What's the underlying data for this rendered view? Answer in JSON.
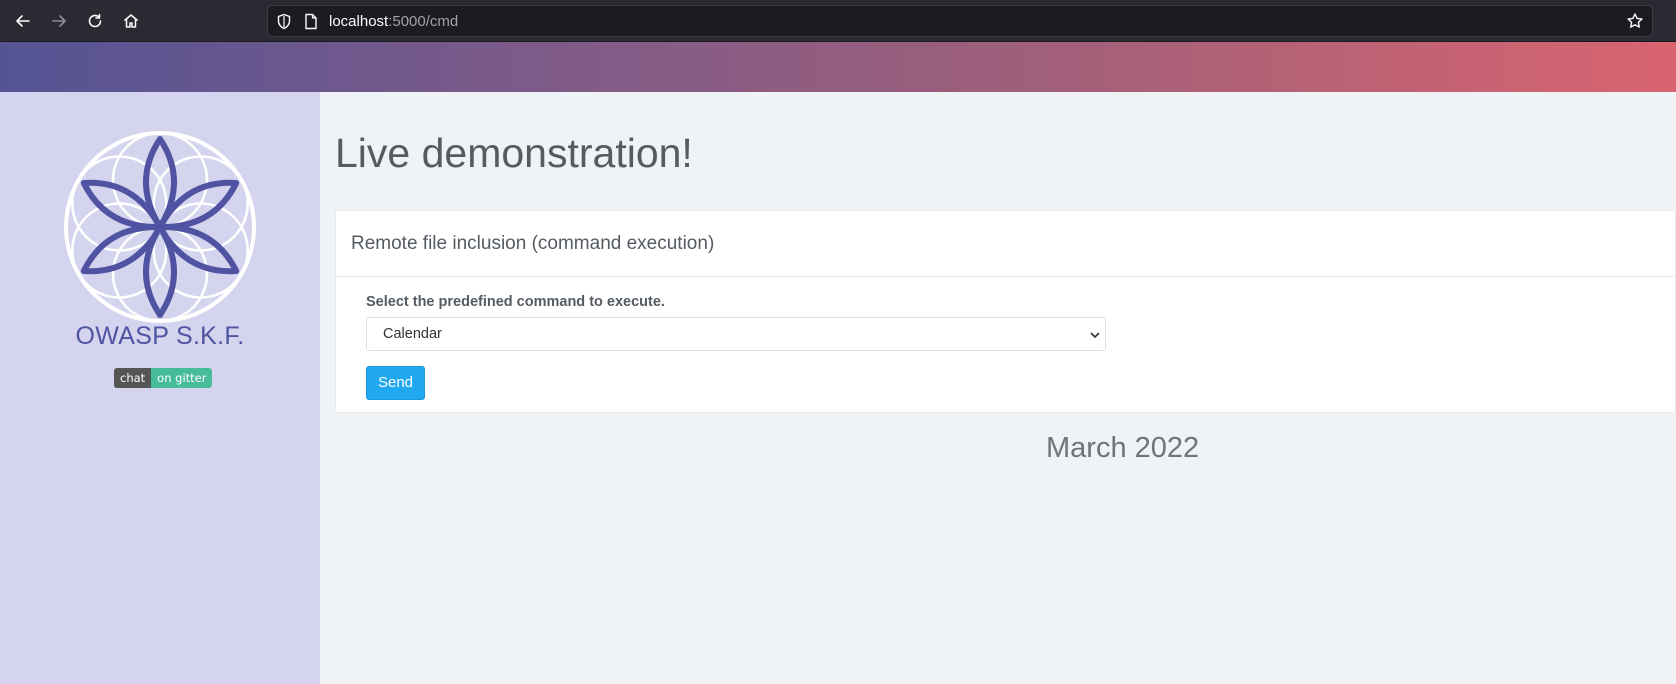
{
  "browser": {
    "url_host": "localhost",
    "url_path": ":5000/cmd",
    "icons": [
      "back-arrow-icon",
      "forward-arrow-icon",
      "reload-icon",
      "home-icon",
      "shield-icon",
      "page-icon",
      "bookmark-star-icon"
    ]
  },
  "colors": {
    "header_gradient_start": "#545494",
    "header_gradient_end": "#d96470",
    "sidebar_bg": "#d4d4ee",
    "brand": "#4f53a1",
    "send_button": "#20a8f0",
    "gitter_left": "#555555",
    "gitter_right": "#46bc99"
  },
  "sidebar": {
    "brand_name": "OWASP S.K.F.",
    "badge": {
      "left": "chat",
      "right": "on gitter"
    }
  },
  "main": {
    "page_title": "Live demonstration!",
    "card": {
      "header": "Remote file inclusion (command execution)",
      "field_label": "Select the predefined command to execute.",
      "selected_command": "Calendar",
      "send_label": "Send"
    },
    "calendar_title": "March 2022"
  }
}
